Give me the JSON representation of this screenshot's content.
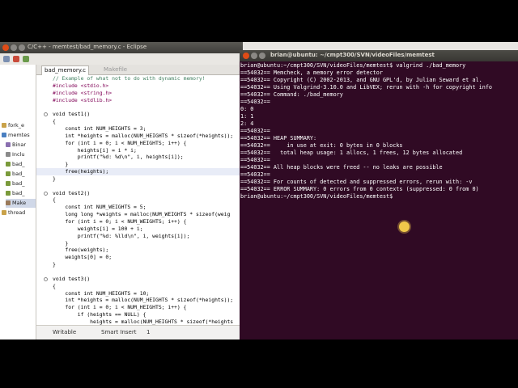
{
  "eclipse": {
    "title": "C/C++ - memtest/bad_memory.c - Eclipse",
    "explorer": [
      "fork_e",
      "memtes",
      "Binar",
      "Inclu",
      "bad_",
      "bad_",
      "bad_",
      "bad_",
      "Make",
      "thread"
    ],
    "tabs": [
      {
        "label": "bad_memory.c",
        "active": true
      },
      {
        "label": "Makefile",
        "active": false
      }
    ],
    "code": [
      {
        "text": "// Example of what not to do with dynamic memory!",
        "color": "#3f7f5f",
        "fold": false
      },
      {
        "text": "#include <stdio.h>",
        "color": "#7f0055",
        "fold": false
      },
      {
        "text": "#include <string.h>",
        "color": "#7f0055",
        "fold": false
      },
      {
        "text": "#include <stdlib.h>",
        "color": "#7f0055",
        "fold": false
      },
      {
        "text": "",
        "color": "#000000",
        "fold": false
      },
      {
        "text": "void test1()",
        "color": "#000000",
        "fold": true
      },
      {
        "text": "{",
        "color": "#000000",
        "fold": false
      },
      {
        "text": "    const int NUM_HEIGHTS = 3;",
        "color": "#000000",
        "fold": false
      },
      {
        "text": "    int *heights = malloc(NUM_HEIGHTS * sizeof(*heights));",
        "color": "#000000",
        "fold": false
      },
      {
        "text": "    for (int i = 0; i < NUM_HEIGHTS; i++) {",
        "color": "#000000",
        "fold": false
      },
      {
        "text": "        heights[i] = i * i;",
        "color": "#000000",
        "fold": false
      },
      {
        "text": "        printf(\"%d: %d\\n\", i, heights[i]);",
        "color": "#000000",
        "fold": false
      },
      {
        "text": "    }",
        "color": "#000000",
        "fold": false
      },
      {
        "text": "    free(heights);",
        "color": "#000000",
        "fold": false,
        "highlight": true
      },
      {
        "text": "}",
        "color": "#000000",
        "fold": false
      },
      {
        "text": "",
        "color": "#000000",
        "fold": false
      },
      {
        "text": "void test2()",
        "color": "#000000",
        "fold": true
      },
      {
        "text": "{",
        "color": "#000000",
        "fold": false
      },
      {
        "text": "    const int NUM_WEIGHTS = 5;",
        "color": "#000000",
        "fold": false
      },
      {
        "text": "    long long *weights = malloc(NUM_WEIGHTS * sizeof(weig",
        "color": "#000000",
        "fold": false
      },
      {
        "text": "    for (int i = 0; i < NUM_WEIGHTS; i++) {",
        "color": "#000000",
        "fold": false
      },
      {
        "text": "        weights[i] = 100 + i;",
        "color": "#000000",
        "fold": false
      },
      {
        "text": "        printf(\"%d: %lld\\n\", i, weights[i]);",
        "color": "#000000",
        "fold": false
      },
      {
        "text": "    }",
        "color": "#000000",
        "fold": false
      },
      {
        "text": "    free(weights);",
        "color": "#000000",
        "fold": false
      },
      {
        "text": "    weights[0] = 0;",
        "color": "#000000",
        "fold": false
      },
      {
        "text": "}",
        "color": "#000000",
        "fold": false
      },
      {
        "text": "",
        "color": "#000000",
        "fold": false
      },
      {
        "text": "void test3()",
        "color": "#000000",
        "fold": true
      },
      {
        "text": "{",
        "color": "#000000",
        "fold": false
      },
      {
        "text": "    const int NUM_HEIGHTS = 10;",
        "color": "#000000",
        "fold": false
      },
      {
        "text": "    int *heights = malloc(NUM_HEIGHTS * sizeof(*heights));",
        "color": "#000000",
        "fold": false
      },
      {
        "text": "    for (int i = 0; i < NUM_HEIGHTS; i++) {",
        "color": "#000000",
        "fold": false
      },
      {
        "text": "        if (heights == NULL) {",
        "color": "#000000",
        "fold": false
      },
      {
        "text": "            heights = malloc(NUM_HEIGHTS * sizeof(*heights",
        "color": "#000000",
        "fold": false
      }
    ],
    "status": {
      "writable": "Writable",
      "insert_mode": "Smart Insert",
      "position": "1"
    }
  },
  "terminal": {
    "title": "brian@ubuntu: ~/cmpt300/SVN/videoFiles/memtest",
    "lines": [
      "brian@ubuntu:~/cmpt300/SVN/videoFiles/memtest$ valgrind ./bad_memory",
      "==54032== Memcheck, a memory error detector",
      "==54032== Copyright (C) 2002-2013, and GNU GPL'd, by Julian Seward et al.",
      "==54032== Using Valgrind-3.10.0 and LibVEX; rerun with -h for copyright info",
      "==54032== Command: ./bad_memory",
      "==54032==",
      "0: 0",
      "1: 1",
      "2: 4",
      "==54032==",
      "==54032== HEAP SUMMARY:",
      "==54032==     in use at exit: 0 bytes in 0 blocks",
      "==54032==   total heap usage: 1 allocs, 1 frees, 12 bytes allocated",
      "==54032==",
      "==54032== All heap blocks were freed -- no leaks are possible",
      "==54032==",
      "==54032== For counts of detected and suppressed errors, rerun with: -v",
      "==54032== ERROR SUMMARY: 0 errors from 0 contexts (suppressed: 0 from 0)",
      "brian@ubuntu:~/cmpt300/SVN/videoFiles/memtest$ "
    ]
  },
  "colors": {
    "terminal_bg": "#300a24",
    "close_button": "#df4b16",
    "min_max_button": "#8a8884",
    "comment": "#3f7f5f",
    "preprocessor": "#7f0055",
    "cursor_highlight": "#f0c84a"
  }
}
